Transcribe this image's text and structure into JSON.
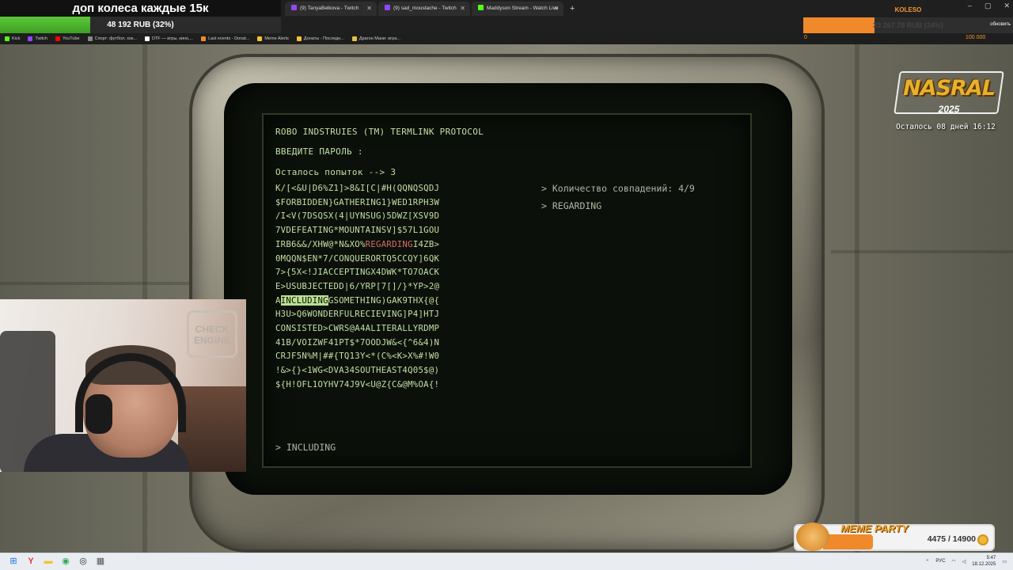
{
  "donation": {
    "title": "доп колеса каждые 15к",
    "progress_text": "48 192 RUB (32%)",
    "progress_fraction": 0.32
  },
  "browser": {
    "tabs": [
      {
        "label": "(9) TanyaBelkova - Twitch",
        "kind": "twitch"
      },
      {
        "label": "(9) sad_moustache - Twitch",
        "kind": "twitch"
      },
      {
        "label": "Maddyson Stream - Watch Live",
        "kind": "kick"
      }
    ],
    "new_tab": "+",
    "window_controls": [
      "–",
      "▢",
      "✕"
    ],
    "bookmarks": [
      "Kick",
      "Twitch",
      "YouTube",
      "Спорт: футбол, хок...",
      "DTF — игры, кино,...",
      "Last events - Donat...",
      "Meme Alerts",
      "Донаты - Последн...",
      "Драгон Мани: игра..."
    ]
  },
  "koleso": {
    "title": "KOLESO",
    "progress_text": "33 267.78 RUB (34%)",
    "progress_fraction": 0.34,
    "min": "0",
    "max": "100 000",
    "refresh": "обновить"
  },
  "terminal": {
    "header": "ROBO INDSTRUIES (TM) TERMLINK PROTOCOL",
    "prompt": "ВВЕДИТЕ ПАРОЛЬ :",
    "attempts": "Осталось попыток --> 3",
    "rows": [
      "K/[<&U|D6%Z1]>8&I[C|#H(QQNQSQDJ",
      "$FORBIDDEN}GATHERING1}WED1RPH3W",
      "/I<V(7DSQSX(4|UYNSUG)5DWZ[XSV9D",
      "7VDEFEATING*MOUNTAINSV]$57L1GOU",
      "IRB6&&/XHW@*N&XO%REGARDINGI4ZB>",
      "0MQQN$EN*7/CONQUERORTQ5CCQY]6QK",
      "7>{5X<!JIACCEPTINGX4DWK*TO7OACK",
      "E>USUBJECTEDD|6/YRP[7[]/}*YP>2@",
      "AINCLUDINGGSOMETHING)GAK9THX{@{",
      "H3U>Q6WONDERFULRECIEVING]P4]HTJ",
      "CONSISTED>CWRS@A4ALITERALLYRDMP",
      "41B/VOIZWF41PT$*7OODJW&<{^6&4)N",
      "CRJF5N%M|##{TQ13Y<*(C%<K>X%#!W0",
      "!&>{}<1WG<DVA34SOUTHEAST4Q05$@)",
      "${H!OFL1OYHV74J9V<U@Z{C&@M%OA{!"
    ],
    "red_row": 4,
    "red_word": "REGARDING",
    "sel_row": 8,
    "sel_word": "INCLUDING",
    "side": [
      "> Количество совпадений: 4/9",
      "> REGARDING"
    ],
    "input": "> INCLUDING"
  },
  "webcam": {
    "sign": "CHECK ENGINE"
  },
  "nasral": {
    "title": "NASRAL",
    "year": "2025",
    "countdown": "Осталось 08 дней 16:12"
  },
  "meme_party": {
    "title": "MEME PARTY",
    "count": "4475 / 14900",
    "progress_fraction": 0.3
  },
  "taskbar": {
    "lang": "РУС",
    "time": "5:47",
    "date": "18.12.2025"
  }
}
